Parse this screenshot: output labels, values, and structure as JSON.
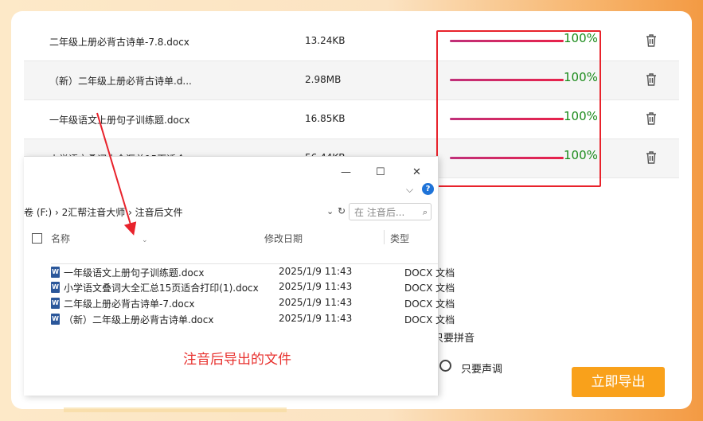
{
  "files": [
    {
      "name": "二年级上册必背古诗单-7.8.docx",
      "size": "13.24KB",
      "progress": 1.0,
      "progress_label": "100%"
    },
    {
      "name": "（新）二年级上册必背古诗单.d...",
      "size": "2.98MB",
      "progress": 1.0,
      "progress_label": "100%"
    },
    {
      "name": "一年级语文上册句子训练题.docx",
      "size": "16.85KB",
      "progress": 1.0,
      "progress_label": "100%"
    },
    {
      "name": "小学语文叠词大全汇总15页适合...",
      "size": "56.44KB",
      "progress": 1.0,
      "progress_label": "100%"
    }
  ],
  "explorer": {
    "window_controls": {
      "minimize": "—",
      "maximize": "☐",
      "close": "✕"
    },
    "address_path": "卷 (F:) › 2汇帮注音大师 › 注音后文件",
    "search_placeholder": "在 注音后...",
    "columns": {
      "name": "名称",
      "date": "修改日期",
      "type": "类型"
    },
    "rows": [
      {
        "name": "一年级语文上册句子训练题.docx",
        "date": "2025/1/9 11:43",
        "type": "DOCX 文档"
      },
      {
        "name": "小学语文叠词大全汇总15页适合打印(1).docx",
        "date": "2025/1/9 11:43",
        "type": "DOCX 文档"
      },
      {
        "name": "二年级上册必背古诗单-7.docx",
        "date": "2025/1/9 11:43",
        "type": "DOCX 文档"
      },
      {
        "name": "（新）二年级上册必背古诗单.docx",
        "date": "2025/1/9 11:43",
        "type": "DOCX 文档"
      }
    ]
  },
  "annotation": "注音后导出的文件",
  "options": {
    "pinyin_only": "只要拼音",
    "tone_only": "只要声调"
  },
  "export_button": "立即导出",
  "colors": {
    "accent_orange": "#f9a11b",
    "highlight_red": "#e8222b",
    "progress_green": "#1a8a1a",
    "bar_start": "#c0307a",
    "bar_end": "#e8224a"
  }
}
